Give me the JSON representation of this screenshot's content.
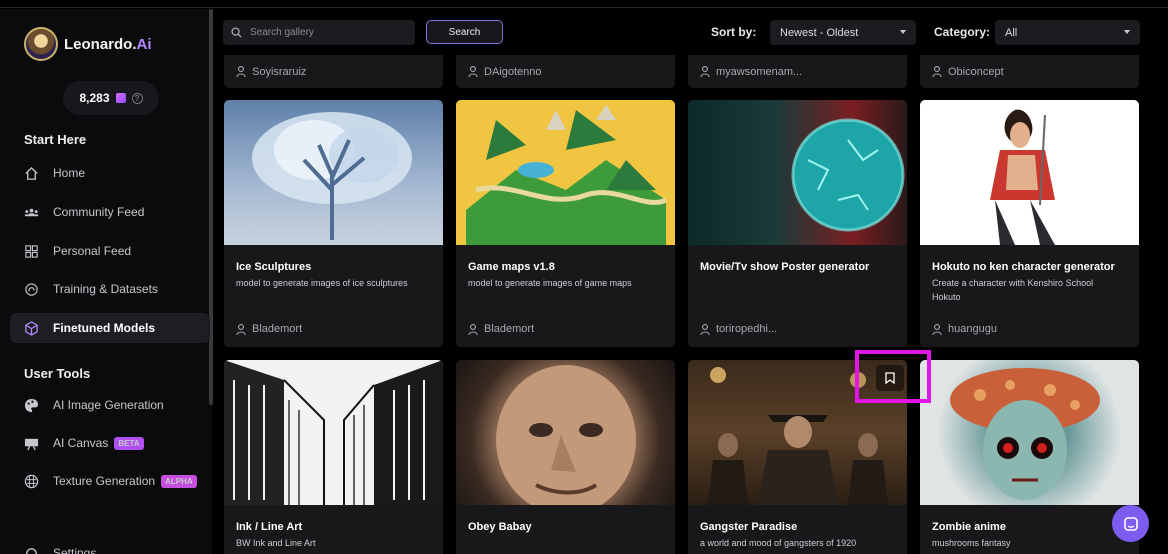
{
  "brand": {
    "name": "Leonardo.",
    "name_suffix": "Ai"
  },
  "credits": {
    "amount": "8,283"
  },
  "sidebar": {
    "start_title": "Start Here",
    "start_items": [
      {
        "label": "Home",
        "icon": "home-icon"
      },
      {
        "label": "Community Feed",
        "icon": "community-icon"
      },
      {
        "label": "Personal Feed",
        "icon": "grid-icon"
      },
      {
        "label": "Training & Datasets",
        "icon": "training-icon"
      },
      {
        "label": "Finetuned Models",
        "icon": "cube-icon",
        "active": true
      }
    ],
    "tools_title": "User Tools",
    "tool_items": [
      {
        "label": "AI Image Generation",
        "icon": "palette-icon"
      },
      {
        "label": "AI Canvas",
        "icon": "canvas-icon",
        "badge": "BETA"
      },
      {
        "label": "Texture Generation",
        "icon": "texture-icon",
        "badge": "ALPHA"
      }
    ],
    "settings_label": "Settings"
  },
  "toolbar": {
    "search_placeholder": "Search gallery",
    "search_button": "Search",
    "sort_label": "Sort by:",
    "sort_value": "Newest - Oldest",
    "category_label": "Category:",
    "category_value": "All"
  },
  "top_row_authors": [
    "Soyisraruiz",
    "DAigotenno",
    "myawsomenam...",
    "Obiconcept"
  ],
  "cards_row1": [
    {
      "title": "Ice Sculptures",
      "desc": "model to generate images of ice sculptures",
      "author": "Blademort"
    },
    {
      "title": "Game maps v1.8",
      "desc": "model to generate images of game maps",
      "author": "Blademort"
    },
    {
      "title": "Movie/Tv show Poster generator",
      "desc": "",
      "author": "toriropedhi..."
    },
    {
      "title": "Hokuto no ken character generator",
      "desc": "Create a character with Kenshiro School Hokuto",
      "author": "huangugu"
    }
  ],
  "cards_row2": [
    {
      "title": "Ink / Line Art",
      "desc": "BW Ink and Line Art"
    },
    {
      "title": "Obey Babay",
      "desc": ""
    },
    {
      "title": "Gangster Paradise",
      "desc": "a world and mood of gangsters of 1920"
    },
    {
      "title": "Zombie anime",
      "desc": "mushrooms fantasy"
    }
  ]
}
